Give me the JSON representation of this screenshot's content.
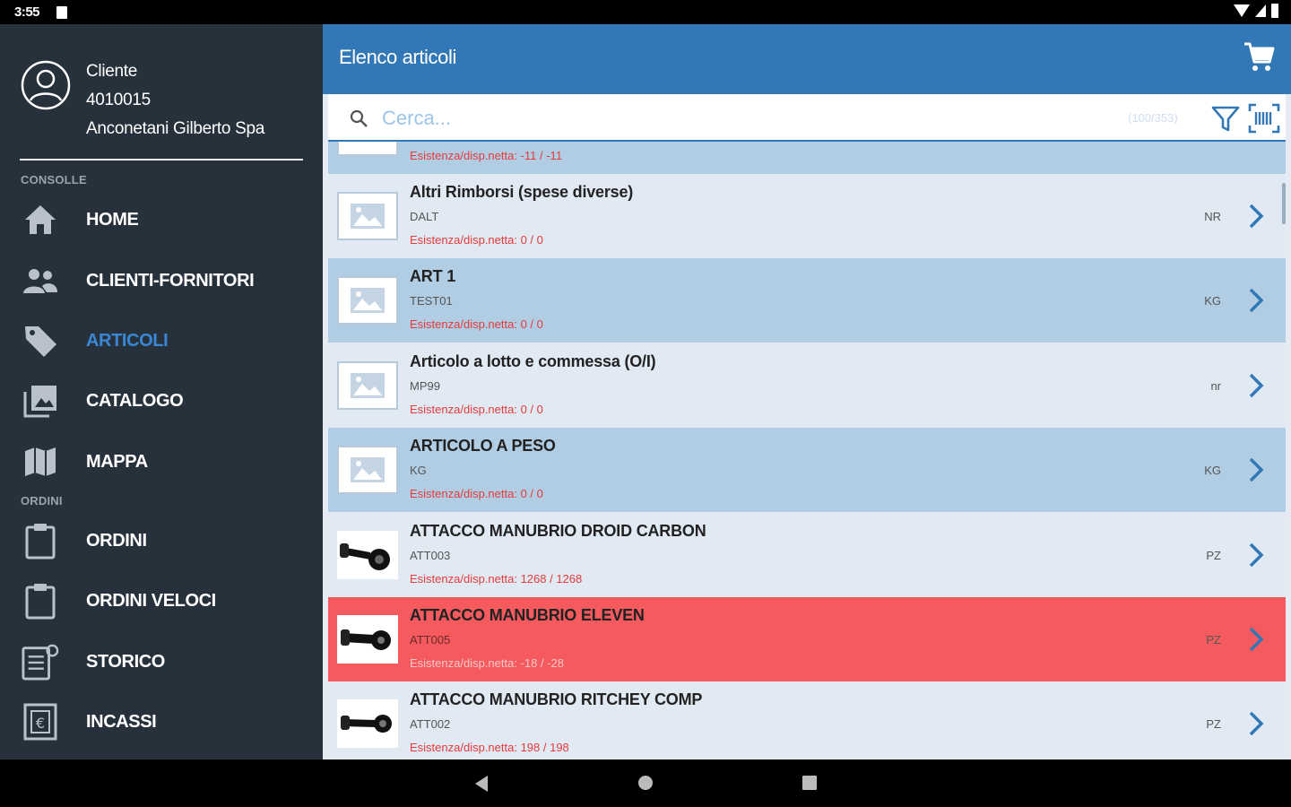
{
  "status_bar": {
    "time": "3:55"
  },
  "sidebar": {
    "user": {
      "label": "Cliente",
      "code": "4010015",
      "name": "Anconetani Gilberto Spa"
    },
    "sections": {
      "console": "CONSOLLE",
      "orders": "ORDINI"
    },
    "items": [
      {
        "label": "HOME",
        "icon": "home-icon"
      },
      {
        "label": "CLIENTI-FORNITORI",
        "icon": "people-icon"
      },
      {
        "label": "ARTICOLI",
        "icon": "tag-icon",
        "active": true
      },
      {
        "label": "CATALOGO",
        "icon": "gallery-icon"
      },
      {
        "label": "MAPPA",
        "icon": "map-icon"
      },
      {
        "label": "ORDINI",
        "icon": "clipboard-icon"
      },
      {
        "label": "ORDINI VELOCI",
        "icon": "clipboard-icon"
      },
      {
        "label": "STORICO",
        "icon": "history-icon"
      },
      {
        "label": "INCASSI",
        "icon": "euro-icon"
      }
    ]
  },
  "main": {
    "title": "Elenco articoli",
    "search": {
      "placeholder": "Cerca...",
      "count": "(100/353)"
    },
    "partial_row": {
      "stock": "Esistenza/disp.netta: -11 / -11"
    },
    "rows": [
      {
        "title": "Altri Rimborsi (spese  diverse)",
        "code": "DALT",
        "unit": "NR",
        "stock": "Esistenza/disp.netta: 0 / 0"
      },
      {
        "title": "ART 1",
        "code": "TEST01",
        "unit": "KG",
        "stock": "Esistenza/disp.netta: 0 / 0"
      },
      {
        "title": "Articolo a lotto e commessa (O/I)",
        "code": "MP99",
        "unit": "nr",
        "stock": "Esistenza/disp.netta: 0 / 0"
      },
      {
        "title": "ARTICOLO A PESO",
        "code": "KG",
        "unit": "KG",
        "stock": "Esistenza/disp.netta: 0 / 0"
      },
      {
        "title": "ATTACCO MANUBRIO DROID CARBON",
        "code": "ATT003",
        "unit": "PZ",
        "stock": "Esistenza/disp.netta: 1268 / 1268"
      },
      {
        "title": "ATTACCO MANUBRIO ELEVEN",
        "code": "ATT005",
        "unit": "PZ",
        "stock": "Esistenza/disp.netta: -18 / -28"
      },
      {
        "title": "ATTACCO MANUBRIO RITCHEY COMP",
        "code": "ATT002",
        "unit": "PZ",
        "stock": "Esistenza/disp.netta: 198 / 198"
      }
    ]
  },
  "colors": {
    "sidebar_bg": "#27313c",
    "accent": "#3278b6",
    "active_nav": "#3a87d6",
    "alert_row": "#f45a5e",
    "stock_text": "#e53b3b"
  }
}
